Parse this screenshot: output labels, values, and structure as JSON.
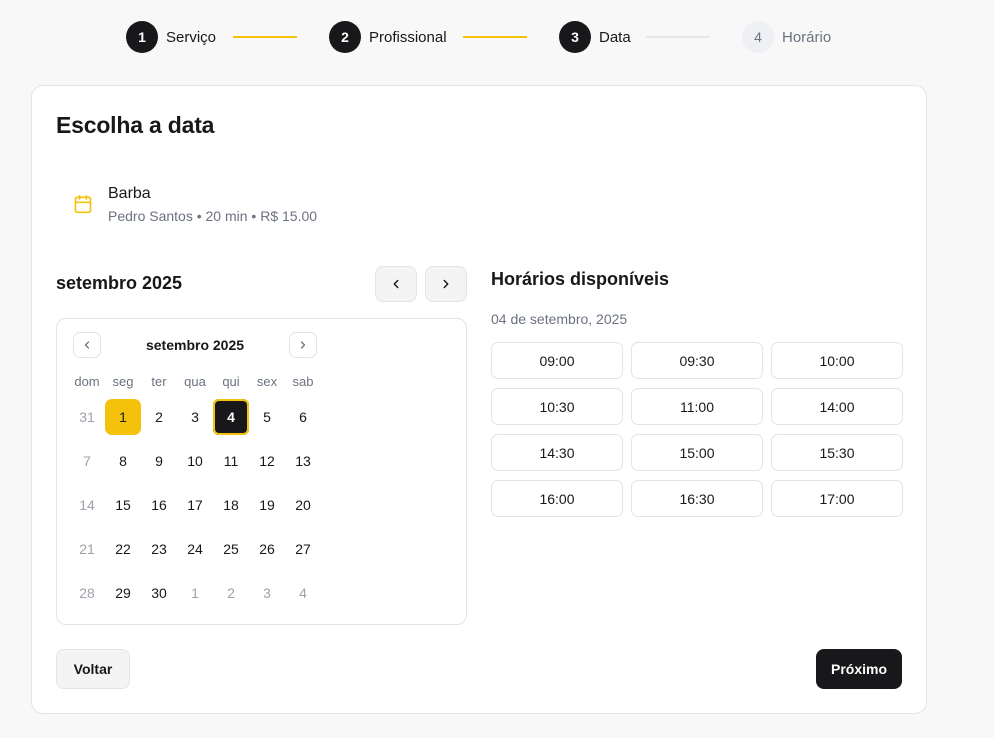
{
  "stepper": {
    "steps": [
      {
        "number": "1",
        "label": "Serviço",
        "state": "done"
      },
      {
        "number": "2",
        "label": "Profissional",
        "state": "done"
      },
      {
        "number": "3",
        "label": "Data",
        "state": "active"
      },
      {
        "number": "4",
        "label": "Horário",
        "state": "pending"
      }
    ]
  },
  "card": {
    "title": "Escolha a data",
    "service": {
      "icon": "calendar-icon",
      "name": "Barba",
      "details": "Pedro Santos • 20 min • R$ 15.00"
    }
  },
  "month_nav": {
    "label": "setembro 2025",
    "prev_icon": "chevron-left-icon",
    "next_icon": "chevron-right-icon"
  },
  "calendar": {
    "caption": "setembro 2025",
    "weekdays": [
      "dom",
      "seg",
      "ter",
      "qua",
      "qui",
      "sex",
      "sab"
    ],
    "weeks": [
      [
        "31",
        "1",
        "2",
        "3",
        "4",
        "5",
        "6"
      ],
      [
        "7",
        "8",
        "9",
        "10",
        "11",
        "12",
        "13"
      ],
      [
        "14",
        "15",
        "16",
        "17",
        "18",
        "19",
        "20"
      ],
      [
        "21",
        "22",
        "23",
        "24",
        "25",
        "26",
        "27"
      ],
      [
        "28",
        "29",
        "30",
        "1",
        "2",
        "3",
        "4"
      ]
    ],
    "today": "1",
    "selected": "4"
  },
  "times": {
    "title": "Horários disponíveis",
    "date": "04 de setembro, 2025",
    "slots": [
      "09:00",
      "09:30",
      "10:00",
      "10:30",
      "11:00",
      "14:00",
      "14:30",
      "15:00",
      "15:30",
      "16:00",
      "16:30",
      "17:00"
    ]
  },
  "footer": {
    "back_label": "Voltar",
    "next_label": "Próximo"
  },
  "colors": {
    "accent": "#f5c20b",
    "dark": "#18181b",
    "muted": "#6b7280"
  }
}
